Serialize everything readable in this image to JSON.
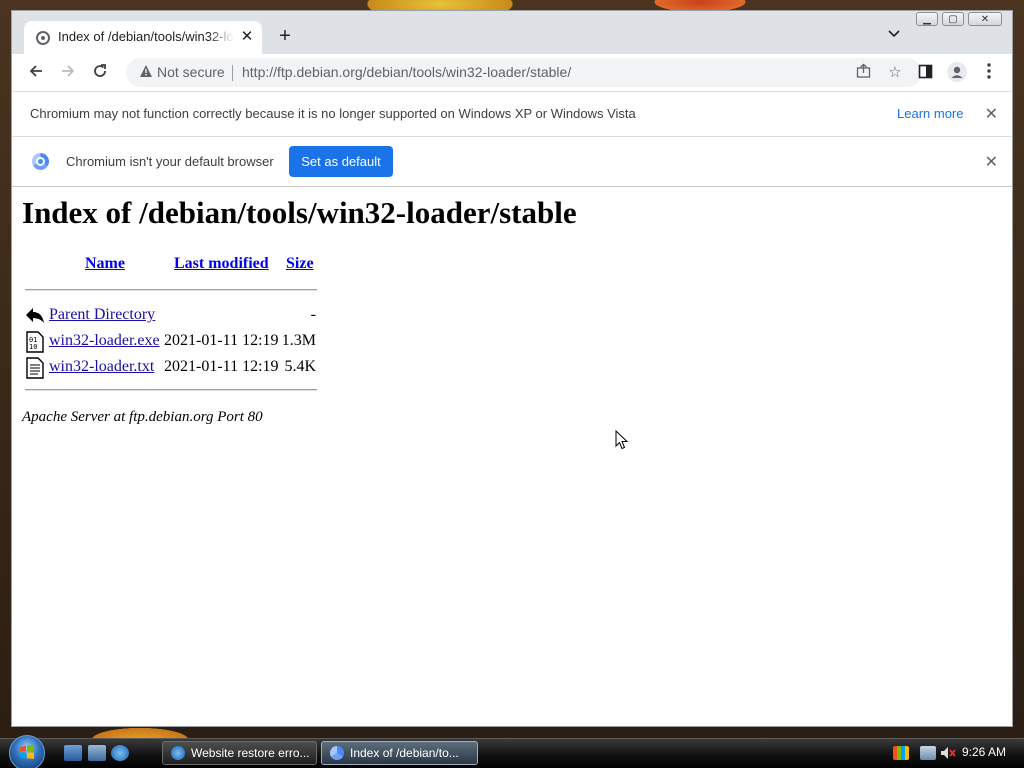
{
  "browser": {
    "tab_title": "Index of /debian/tools/win32-loader/stable",
    "security_label": "Not secure",
    "url": "http://ftp.debian.org/debian/tools/win32-loader/stable/"
  },
  "infobar_unsupported": {
    "message": "Chromium may not function correctly because it is no longer supported on Windows XP or Windows Vista",
    "learn_more": "Learn more"
  },
  "infobar_default": {
    "message": "Chromium isn't your default browser",
    "button": "Set as default"
  },
  "page": {
    "heading": "Index of /debian/tools/win32-loader/stable",
    "columns": [
      "Name",
      "Last modified",
      "Size"
    ],
    "rows": [
      {
        "icon": "back-arrow-icon",
        "name": "Parent Directory",
        "modified": "",
        "size": "-"
      },
      {
        "icon": "binary-file-icon",
        "name": "win32-loader.exe",
        "modified": "2021-01-11 12:19",
        "size": "1.3M"
      },
      {
        "icon": "text-file-icon",
        "name": "win32-loader.txt",
        "modified": "2021-01-11 12:19",
        "size": "5.4K"
      }
    ],
    "server_signature": "Apache Server at ftp.debian.org Port 80"
  },
  "taskbar": {
    "tasks": [
      {
        "label": "Website restore erro...",
        "icon": "internet-explorer-icon",
        "active": false
      },
      {
        "label": "Index of /debian/to...",
        "icon": "chromium-icon",
        "active": true
      }
    ],
    "clock": "9:26 AM"
  },
  "colors": {
    "link": "#1a0dab",
    "accent_button": "#1a73e8",
    "learn_more": "#1a73e8"
  }
}
